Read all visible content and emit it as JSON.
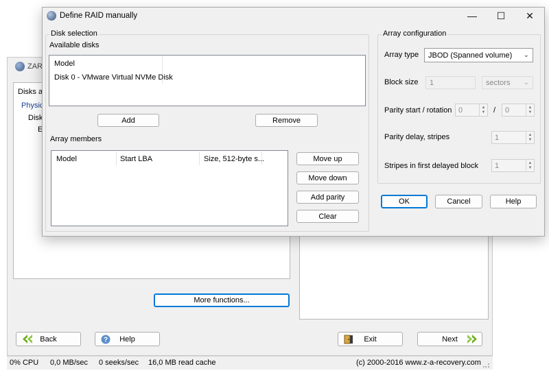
{
  "background": {
    "title": "ZAR",
    "tree_header": "Disks ar",
    "tree_items": [
      "Physic",
      "Disk",
      "E"
    ],
    "more_button": "More functions...",
    "nav": {
      "back": "Back",
      "help": "Help",
      "exit": "Exit",
      "next": "Next"
    },
    "status": {
      "cpu": "0% CPU",
      "rate": "0,0 MB/sec",
      "seeks": "0 seeks/sec",
      "cache": "16,0 MB read cache",
      "copyright": "(c) 2000-2016 www.z-a-recovery.com"
    }
  },
  "dialog": {
    "title": "Define RAID manually",
    "controls": {
      "minimize": "—",
      "maximize": "☐",
      "close": "✕"
    },
    "disk_selection": {
      "group_label": "Disk selection",
      "available_label": "Available disks",
      "column_header": "Model",
      "disks": [
        "Disk 0 - VMware Virtual NVMe Disk"
      ],
      "add": "Add",
      "remove": "Remove"
    },
    "array_members": {
      "label": "Array members",
      "columns": [
        "Model",
        "Start LBA",
        "Size, 512-byte s..."
      ],
      "buttons": {
        "move_up": "Move up",
        "move_down": "Move down",
        "add_parity": "Add parity",
        "clear": "Clear"
      }
    },
    "array_config": {
      "group_label": "Array configuration",
      "array_type_label": "Array type",
      "array_type_value": "JBOD (Spanned volume)",
      "block_size_label": "Block size",
      "block_size_value": "1",
      "block_size_unit": "sectors",
      "parity_start_label": "Parity start / rotation",
      "parity_start_value": "0",
      "parity_sep": "/",
      "parity_rotation_value": "0",
      "parity_delay_label": "Parity delay, stripes",
      "parity_delay_value": "1",
      "stripes_delayed_label": "Stripes in first delayed block",
      "stripes_delayed_value": "1"
    },
    "buttons": {
      "ok": "OK",
      "cancel": "Cancel",
      "help": "Help"
    }
  }
}
